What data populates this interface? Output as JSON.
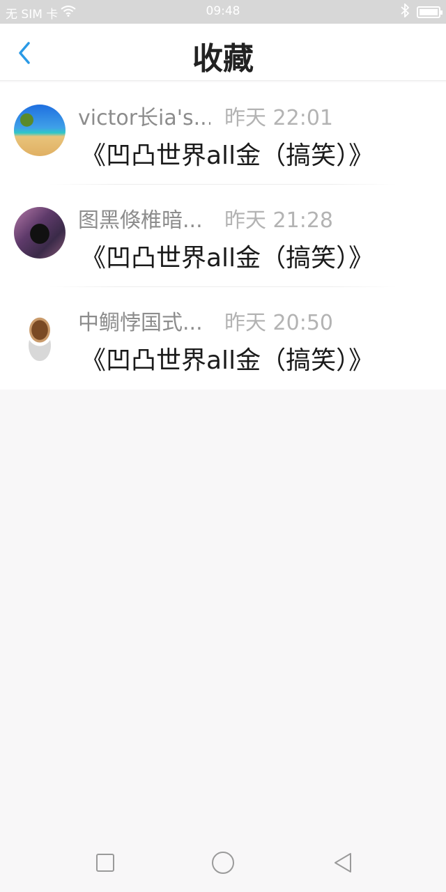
{
  "status_bar": {
    "carrier": "无 SIM 卡",
    "time": "09:48"
  },
  "header": {
    "title": "收藏",
    "back_icon": "chevron-left-icon",
    "accent": "#2a9ae6"
  },
  "items": [
    {
      "name": "victor长ia's...",
      "time": "昨天 22:01",
      "message": "《凹凸世界all金（搞笑）》",
      "avatar": "beach-avatar"
    },
    {
      "name": "图黑倏椎暗...",
      "time": "昨天 21:28",
      "message": "《凹凸世界all金（搞笑）》",
      "avatar": "girl-avatar"
    },
    {
      "name": "中鲷悖国式...",
      "time": "昨天 20:50",
      "message": "《凹凸世界all金（搞笑）》",
      "avatar": "coffee-avatar"
    }
  ],
  "nav_bar": {
    "recent_icon": "square-icon",
    "home_icon": "circle-icon",
    "back_icon": "triangle-back-icon"
  }
}
